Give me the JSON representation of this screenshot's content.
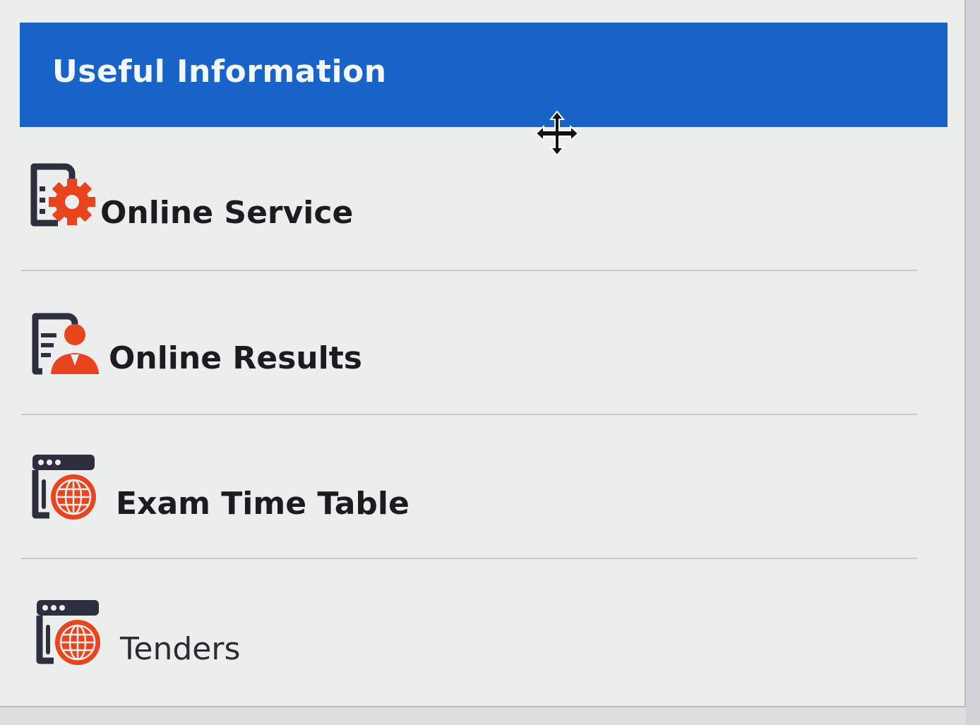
{
  "panel": {
    "title": "Useful Information"
  },
  "items": [
    {
      "label": "Online Service",
      "icon": "document-gear-icon"
    },
    {
      "label": "Online Results",
      "icon": "document-person-icon"
    },
    {
      "label": "Exam Time Table",
      "icon": "browser-globe-icon"
    },
    {
      "label": "Tenders",
      "icon": "browser-globe-icon"
    }
  ],
  "colors": {
    "header_bg": "#1763c7",
    "header_text": "#f2f5fb",
    "accent": "#e8441e",
    "icon_dark": "#2b2f3e",
    "panel_bg": "#eceeee"
  },
  "cursor": {
    "type": "move-cursor-icon"
  }
}
